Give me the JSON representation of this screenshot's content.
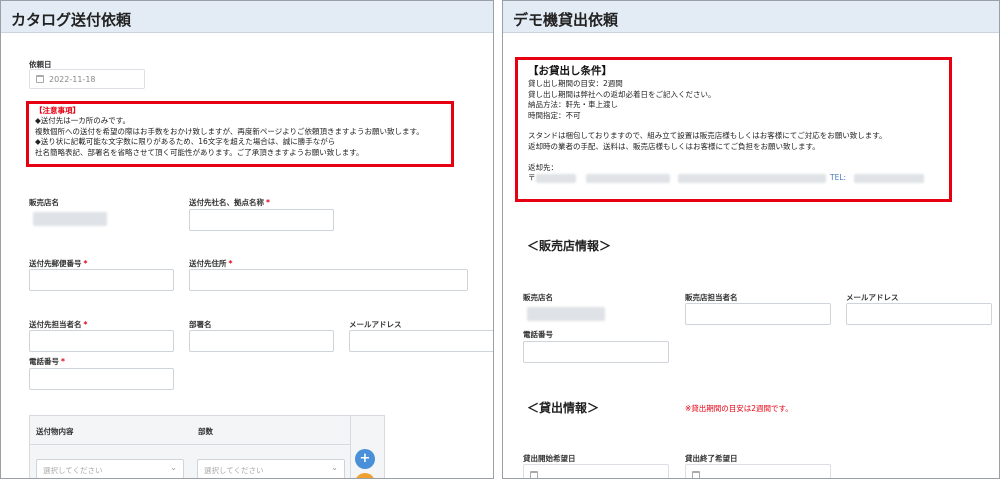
{
  "left": {
    "title": "カタログ送付依頼",
    "request_date_label": "依頼日",
    "request_date_value": "2022-11-18",
    "notice": {
      "title": "【注意事項】",
      "lines": [
        "◆送付先は一カ所のみです。",
        "複数個所への送付を希望の際はお手数をおかけ致しますが、再度新ページよりご依頼頂きますようお願い致します。",
        "◆送り状に記載可能な文字数に限りがあるため、16文字を超えた場合は、誠に勝手ながら",
        "社名簡略表記、部署名を省略させて頂く可能性があります。ご了承頂きますようお願い致します。"
      ]
    },
    "shop_name_label": "販売店名",
    "dest_company_label": "送付先社名、拠点名称",
    "postal_label": "送付先郵便番号",
    "address_label": "送付先住所",
    "contact_label": "送付先担当者名",
    "dept_label": "部署名",
    "email_label": "メールアドレス",
    "phone_label": "電話番号",
    "required_mark": "*",
    "table": {
      "col1": "送付物内容",
      "col2": "部数",
      "select1_placeholder": "選択してください",
      "select2_placeholder": "選択してください",
      "select_arrow": "⌄",
      "add_symbol": "+"
    },
    "colors": {
      "add_button": "#4a90d9",
      "remove_button": "#f0a030"
    }
  },
  "right": {
    "title": "デモ機貸出依頼",
    "conditions": {
      "title": "【お貸出し条件】",
      "lines": [
        "貸し出し期間の目安：2週間",
        "貸し出し期間は弊社への返却必着日をご記入ください。",
        "納品方法：軒先・車上渡し",
        "時間指定：不可",
        "",
        "スタンドは梱包しておりますので、組み立て設置は販売店様もしくはお客様にてご対応をお願い致します。",
        "返却時の業者の手配、送料は、販売店様もしくはお客様にてご負担をお願い致します。",
        ""
      ],
      "return_label": "返却先：",
      "postal_prefix": "〒",
      "tel_label": "TEL:"
    },
    "shop_section_title": "＜販売店情報＞",
    "shop_name_label": "販売店名",
    "shop_contact_label": "販売店担当者名",
    "email_label": "メールアドレス",
    "phone_label": "電話番号",
    "loan_section_title": "＜貸出情報＞",
    "loan_warning": "※貸出期間の目安は2週間です。",
    "loan_start_label": "貸出開始希望日",
    "loan_end_label": "貸出終了希望日"
  }
}
